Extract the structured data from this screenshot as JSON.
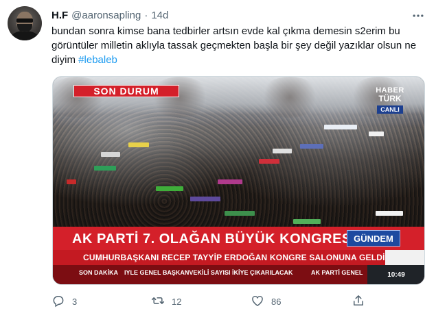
{
  "author": {
    "name": "H.F",
    "handle": "@aaronsapling",
    "separator": "·",
    "time": "14d"
  },
  "tweet": {
    "text": "bundan sonra kimse bana tedbirler artsın evde kal çıkma demesin s2erim bu görüntüler milletin aklıyla tassak geçmekten başla bir şey değil yazıklar olsun ne diyim ",
    "hashtag": "#lebaleb"
  },
  "media": {
    "badge": "SON DURUM",
    "logo_line1": "HABER",
    "logo_line2": "TÜRK",
    "logo_live": "CANLI",
    "headline": "AK PARTİ 7. OLAĞAN BÜYÜK KONGRESİ",
    "section": "GÜNDEM",
    "subheadline": "CUMHURBAŞKANI RECEP TAYYİP ERDOĞAN KONGRE SALONUNA GELDİ",
    "ticker_label": "SON DAKİKA",
    "ticker_text": "IYLE GENEL BAŞKANVEKİLİ SAYISI İKİYE ÇIKARILACAK",
    "ticker_text2": "AK PARTİ GENEL",
    "clock": "10:49"
  },
  "actions": {
    "replies": "3",
    "retweets": "12",
    "likes": "86"
  },
  "icons": {
    "more": "more-icon",
    "reply": "reply-icon",
    "retweet": "retweet-icon",
    "like": "heart-icon",
    "share": "share-icon"
  },
  "colors": {
    "link": "#1d9bf0",
    "muted": "#536471",
    "news_red": "#d4202a",
    "news_blue": "#1d4aa0"
  }
}
